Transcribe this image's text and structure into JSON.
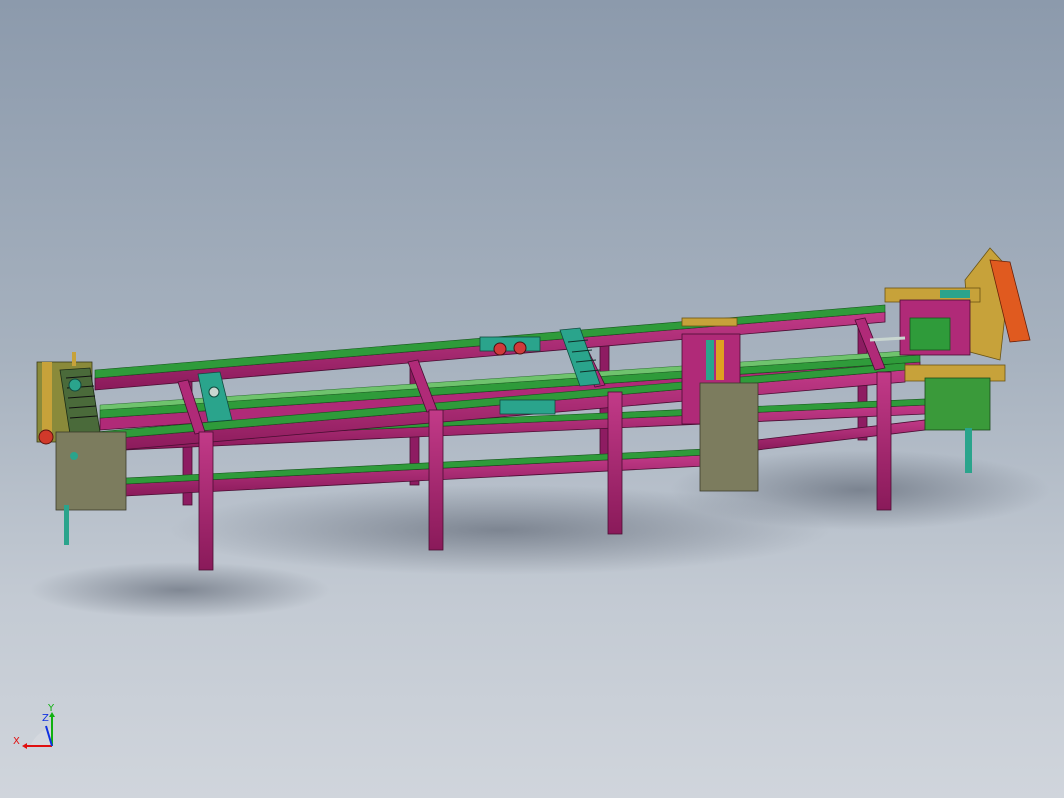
{
  "viewport": {
    "background_top": "#8c9aac",
    "background_bottom": "#d0d5dc"
  },
  "model": {
    "frame_color": "#a8206e",
    "rail_color": "#2f9b3a",
    "plate_color": "#7c7c5e",
    "accent_teal": "#2aa48c",
    "accent_orange": "#e05a1f",
    "yellow_frame": "#c7a23a"
  },
  "triad": {
    "x_label": "X",
    "y_label": "Y",
    "z_label": "Z",
    "x_color": "#e01010",
    "y_color": "#10b010",
    "z_color": "#1030e0"
  }
}
